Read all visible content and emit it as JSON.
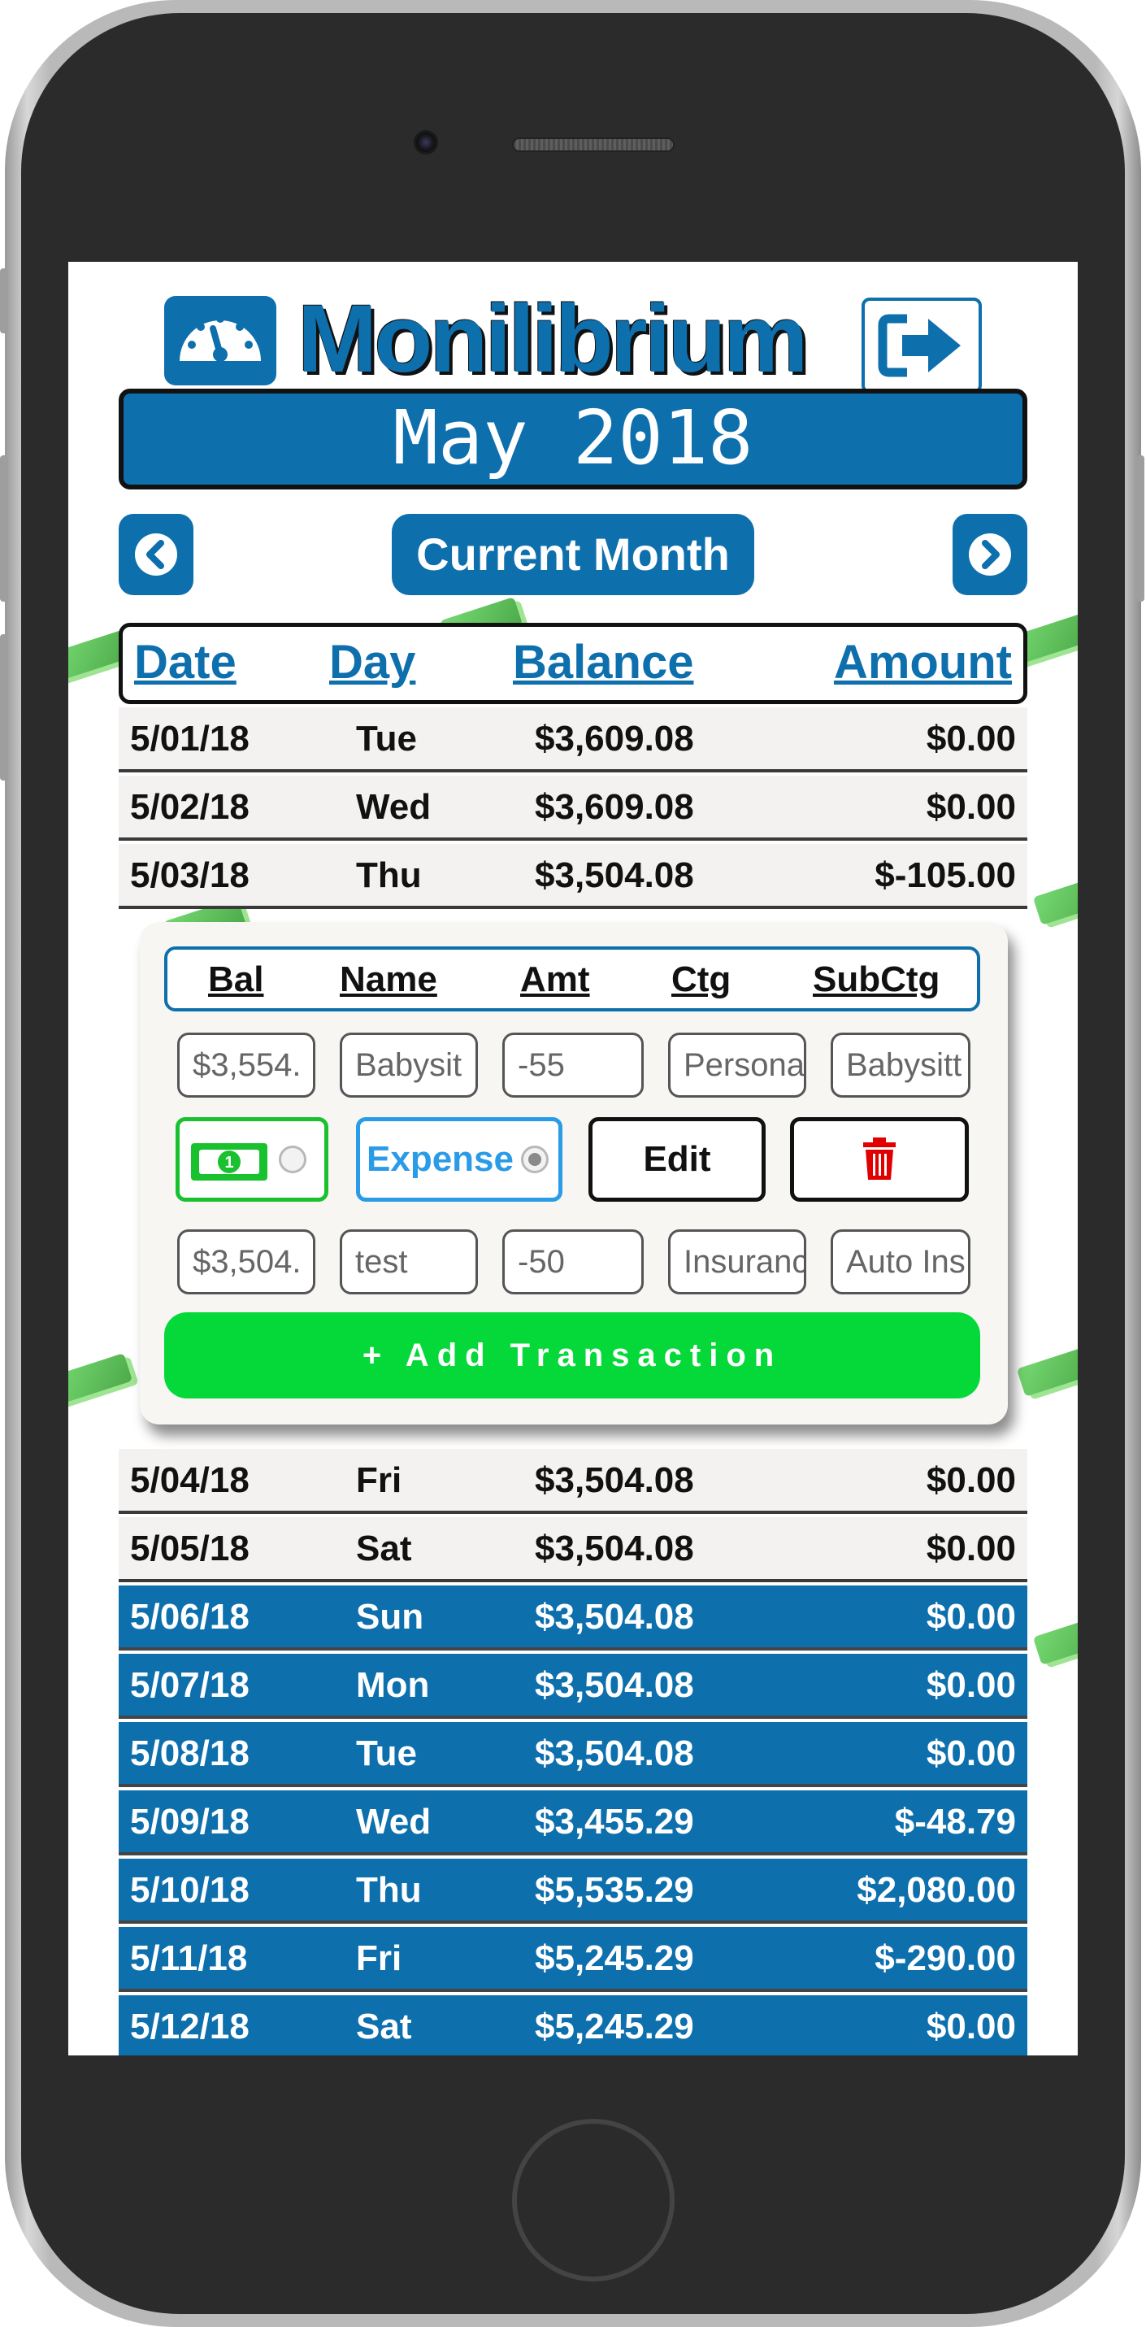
{
  "app": {
    "title": "Monilibrium"
  },
  "month_banner": "May 2018",
  "nav": {
    "current_month_label": "Current Month"
  },
  "columns": {
    "date": "Date",
    "day": "Day",
    "balance": "Balance",
    "amount": "Amount"
  },
  "days_top": [
    {
      "date": "5/01/18",
      "day": "Tue",
      "balance": "$3,609.08",
      "amount": "$0.00"
    },
    {
      "date": "5/02/18",
      "day": "Wed",
      "balance": "$3,609.08",
      "amount": "$0.00"
    },
    {
      "date": "5/03/18",
      "day": "Thu",
      "balance": "$3,504.08",
      "amount": "$-105.00"
    }
  ],
  "transactions_panel": {
    "headers": {
      "bal": "Bal",
      "name": "Name",
      "amt": "Amt",
      "ctg": "Ctg",
      "subctg": "SubCtg"
    },
    "existing": {
      "bal": "$3,554.",
      "name": "Babysit",
      "amt": "-55",
      "ctg": "Persona",
      "subctg": "Babysitt"
    },
    "type_expense_label": "Expense",
    "edit_label": "Edit",
    "new": {
      "bal": "$3,504.",
      "name": "test",
      "amt": "-50",
      "ctg": "Insuranc",
      "subctg": "Auto Ins"
    },
    "add_label": "+ Add Transaction"
  },
  "days_bottom": [
    {
      "date": "5/04/18",
      "day": "Fri",
      "balance": "$3,504.08",
      "amount": "$0.00",
      "style": "light"
    },
    {
      "date": "5/05/18",
      "day": "Sat",
      "balance": "$3,504.08",
      "amount": "$0.00",
      "style": "light"
    },
    {
      "date": "5/06/18",
      "day": "Sun",
      "balance": "$3,504.08",
      "amount": "$0.00",
      "style": "dark"
    },
    {
      "date": "5/07/18",
      "day": "Mon",
      "balance": "$3,504.08",
      "amount": "$0.00",
      "style": "dark"
    },
    {
      "date": "5/08/18",
      "day": "Tue",
      "balance": "$3,504.08",
      "amount": "$0.00",
      "style": "dark"
    },
    {
      "date": "5/09/18",
      "day": "Wed",
      "balance": "$3,455.29",
      "amount": "$-48.79",
      "style": "dark"
    },
    {
      "date": "5/10/18",
      "day": "Thu",
      "balance": "$5,535.29",
      "amount": "$2,080.00",
      "style": "dark"
    },
    {
      "date": "5/11/18",
      "day": "Fri",
      "balance": "$5,245.29",
      "amount": "$-290.00",
      "style": "dark"
    },
    {
      "date": "5/12/18",
      "day": "Sat",
      "balance": "$5,245.29",
      "amount": "$0.00",
      "style": "dark"
    }
  ],
  "colors": {
    "brand_blue": "#0e6fad",
    "add_green": "#05d93a",
    "expense_blue": "#2a9be6",
    "delete_red": "#e00000"
  },
  "icons": {
    "logo": "speedometer-icon",
    "logout": "sign-out-arrow-icon",
    "prev": "chevron-left-icon",
    "next": "chevron-right-icon",
    "cash": "dollar-bill-icon",
    "delete": "trash-icon"
  }
}
